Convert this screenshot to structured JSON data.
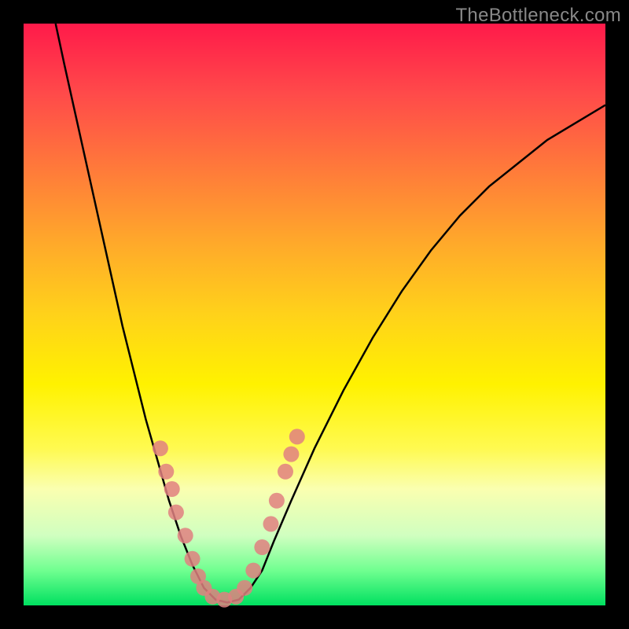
{
  "watermark": "TheBottleneck.com",
  "chart_data": {
    "type": "line",
    "title": "",
    "xlabel": "",
    "ylabel": "",
    "xlim": [
      0,
      100
    ],
    "ylim": [
      0,
      100
    ],
    "curve": {
      "name": "bottleneck-curve",
      "color": "#000000",
      "points": [
        {
          "x": 5.5,
          "y": 100
        },
        {
          "x": 7,
          "y": 93
        },
        {
          "x": 9,
          "y": 84
        },
        {
          "x": 11,
          "y": 75
        },
        {
          "x": 13,
          "y": 66
        },
        {
          "x": 15,
          "y": 57
        },
        {
          "x": 17,
          "y": 48
        },
        {
          "x": 19,
          "y": 40
        },
        {
          "x": 21,
          "y": 32
        },
        {
          "x": 23,
          "y": 25
        },
        {
          "x": 25,
          "y": 18
        },
        {
          "x": 27,
          "y": 12
        },
        {
          "x": 29,
          "y": 7
        },
        {
          "x": 31,
          "y": 3
        },
        {
          "x": 33,
          "y": 1
        },
        {
          "x": 35,
          "y": 0.5
        },
        {
          "x": 37,
          "y": 1
        },
        {
          "x": 39,
          "y": 3
        },
        {
          "x": 41,
          "y": 6
        },
        {
          "x": 43,
          "y": 11
        },
        {
          "x": 46,
          "y": 18
        },
        {
          "x": 50,
          "y": 27
        },
        {
          "x": 55,
          "y": 37
        },
        {
          "x": 60,
          "y": 46
        },
        {
          "x": 65,
          "y": 54
        },
        {
          "x": 70,
          "y": 61
        },
        {
          "x": 75,
          "y": 67
        },
        {
          "x": 80,
          "y": 72
        },
        {
          "x": 85,
          "y": 76
        },
        {
          "x": 90,
          "y": 80
        },
        {
          "x": 95,
          "y": 83
        },
        {
          "x": 100,
          "y": 86
        }
      ]
    },
    "markers": {
      "name": "data-points",
      "color": "#e08080",
      "radius": 10,
      "points": [
        {
          "x": 23.5,
          "y": 27
        },
        {
          "x": 24.5,
          "y": 23
        },
        {
          "x": 25.5,
          "y": 20
        },
        {
          "x": 26.2,
          "y": 16
        },
        {
          "x": 27.8,
          "y": 12
        },
        {
          "x": 29.0,
          "y": 8
        },
        {
          "x": 30.0,
          "y": 5
        },
        {
          "x": 31.0,
          "y": 3
        },
        {
          "x": 32.5,
          "y": 1.5
        },
        {
          "x": 34.5,
          "y": 1
        },
        {
          "x": 36.5,
          "y": 1.5
        },
        {
          "x": 38.0,
          "y": 3
        },
        {
          "x": 39.5,
          "y": 6
        },
        {
          "x": 41.0,
          "y": 10
        },
        {
          "x": 42.5,
          "y": 14
        },
        {
          "x": 43.5,
          "y": 18
        },
        {
          "x": 45.0,
          "y": 23
        },
        {
          "x": 46.0,
          "y": 26
        },
        {
          "x": 47.0,
          "y": 29
        }
      ]
    }
  }
}
